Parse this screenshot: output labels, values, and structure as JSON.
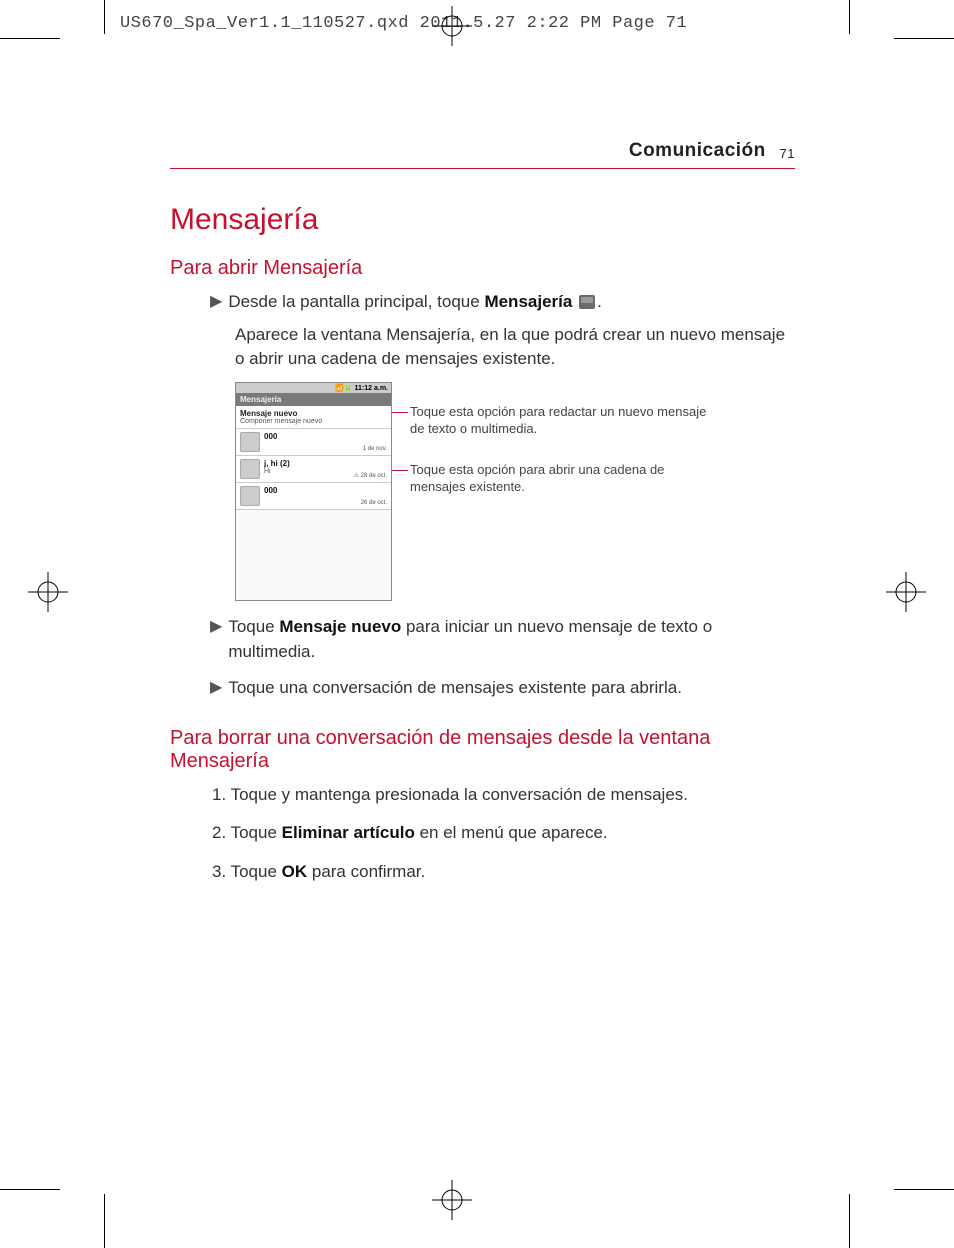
{
  "header": "US670_Spa_Ver1.1_110527.qxd  2011.5.27  2:22 PM  Page 71",
  "section": "Comunicación",
  "page_num": "71",
  "h1": "Mensajería",
  "s1": {
    "title": "Para abrir Mensajería",
    "b1_a": "Desde la pantalla principal, toque ",
    "b1_b": "Mensajería",
    "b1_c": ".",
    "p1": "Aparece la ventana Mensajería, en la que podrá crear un nuevo mensaje o abrir una cadena de mensajes existente.",
    "b2_a": "Toque ",
    "b2_b": "Mensaje nuevo",
    "b2_c": " para iniciar un nuevo mensaje de texto o multimedia.",
    "b3": "Toque una conversación de mensajes existente para abrirla."
  },
  "phone": {
    "time": "11:12 a.m.",
    "title": "Mensajería",
    "new1": "Mensaje nuevo",
    "new2": "Componer mensaje nuevo",
    "threads": [
      {
        "name": "000",
        "sub": "",
        "date": "1 de nov."
      },
      {
        "name": "j, hi (2)",
        "sub": "Hi",
        "date": "⚠ 28 de oct."
      },
      {
        "name": "000",
        "sub": "",
        "date": "26 de oct."
      }
    ]
  },
  "callouts": {
    "c1": "Toque esta opción para redactar un nuevo mensaje de texto o multimedia.",
    "c2": "Toque esta opción para abrir una cadena de mensajes existente."
  },
  "s2": {
    "title": "Para borrar una conversación de mensajes desde la ventana Mensajería",
    "o1": "1. Toque y mantenga presionada la conversación de mensajes.",
    "o2_a": "2. Toque ",
    "o2_b": "Eliminar artículo",
    "o2_c": " en el menú que aparece.",
    "o3_a": "3. Toque ",
    "o3_b": "OK",
    "o3_c": " para confirmar."
  }
}
